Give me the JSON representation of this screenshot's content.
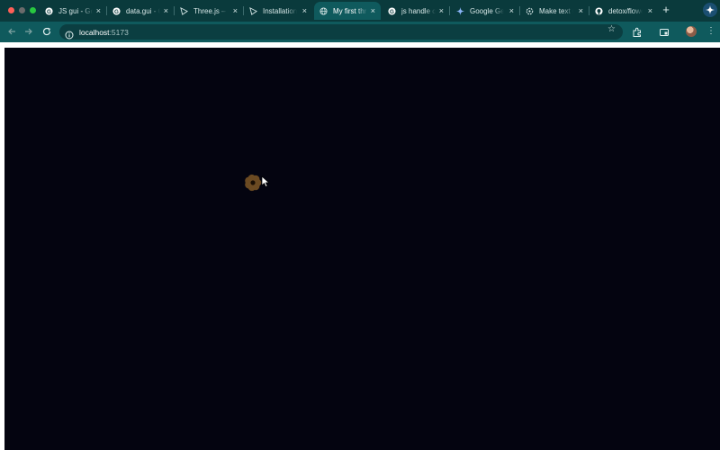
{
  "browser": {
    "tabs": [
      {
        "label": "JS gui - Google",
        "favicon": "google-icon",
        "active": false
      },
      {
        "label": "data.gui - Google",
        "favicon": "google-icon",
        "active": false
      },
      {
        "label": "Three.js – JavaScript",
        "favicon": "threejs-icon",
        "active": false
      },
      {
        "label": "Installation",
        "favicon": "threejs-icon",
        "active": false
      },
      {
        "label": "My first three.js app",
        "favicon": "globe-icon",
        "active": true
      },
      {
        "label": "js handle click",
        "favicon": "google-icon",
        "active": false
      },
      {
        "label": "Google Gemini",
        "favicon": "gemini-icon",
        "active": false
      },
      {
        "label": "Make text unselectable",
        "favicon": "openai-icon",
        "active": false
      },
      {
        "label": "detox/flowers",
        "favicon": "github-icon",
        "active": false
      }
    ],
    "new_tab_label": "+",
    "close_glyph": "×",
    "address": {
      "host": "localhost",
      "port": ":5173"
    }
  },
  "colors": {
    "canvas_background": "#040410",
    "flower_petal": "#6b4a22",
    "flower_center": "#1a0f05",
    "accent": "#0f5a5d"
  }
}
